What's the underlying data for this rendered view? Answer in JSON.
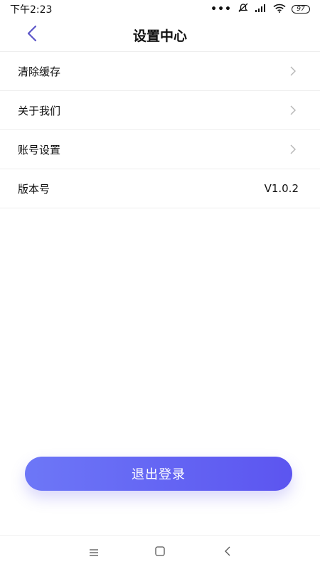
{
  "status_bar": {
    "time": "下午2:23",
    "dots": "•••",
    "battery": "97"
  },
  "header": {
    "title": "设置中心"
  },
  "settings": {
    "items": [
      {
        "label": "清除缓存",
        "has_chevron": true
      },
      {
        "label": "关于我们",
        "has_chevron": true
      },
      {
        "label": "账号设置",
        "has_chevron": true
      },
      {
        "label": "版本号",
        "value": "V1.0.2",
        "has_chevron": false
      }
    ]
  },
  "logout": {
    "label": "退出登录"
  },
  "colors": {
    "accent": "#6066f2",
    "back_icon": "#5b55c8"
  },
  "icons": {
    "back": "chevron-left-icon",
    "row": "chevron-right-icon",
    "nav_menu": "menu-icon",
    "nav_home": "home-square-icon",
    "nav_back": "back-chevron-icon"
  }
}
